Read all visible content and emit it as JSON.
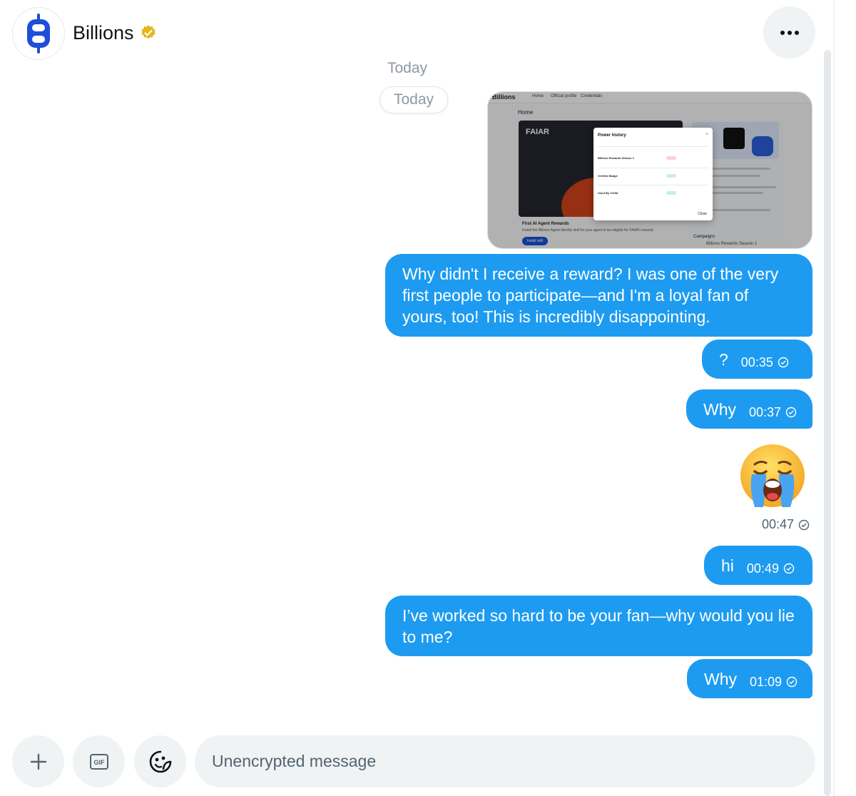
{
  "header": {
    "title": "Billions",
    "verified": true,
    "more_label": "More"
  },
  "conversation": {
    "date_label": "Today",
    "date_pill": "Today",
    "image_message": {
      "nav_logo": "Billions",
      "nav_items": [
        "Home",
        "Official profile",
        "Credentials"
      ],
      "home_label": "Home",
      "card_brand": "FAIAR",
      "card_title": "First AI Agent Rewards",
      "card_text": "Install the Billions Agent Identity skill for your agent to be eligible for FAIAR rewards",
      "card_button": "Install skill",
      "modal_title": "Power history",
      "modal_rows": [
        "Billions Rewards Season 1",
        "Verified Badge",
        "Used By Verfaf"
      ],
      "modal_close": "Close",
      "campaigns_label": "Campaigns",
      "campaign_item": "Billions Rewards Season 1"
    },
    "messages": [
      {
        "text": "Why didn't I receive a reward? I was one of the very first people to participate—and I'm a loyal fan of yours, too! This is incredibly disappointing.",
        "time": ""
      },
      {
        "text": "?",
        "time": "00:35"
      },
      {
        "text": "Why",
        "time": "00:37"
      },
      {
        "emoji": "😭",
        "time": "00:47"
      },
      {
        "text": "hi",
        "time": "00:49"
      },
      {
        "text": "I’ve worked so hard to be your fan—why would you lie to me?",
        "time": ""
      },
      {
        "text": "Why",
        "time": "01:09"
      }
    ]
  },
  "composer": {
    "placeholder": "Unencrypted message",
    "add_icon": "plus-icon",
    "gif_icon": "gif-icon",
    "emoji_icon": "emoji-icon"
  },
  "colors": {
    "bubble": "#1d9bf0",
    "accent": "#1d4ed8",
    "verified": "#e2b719"
  }
}
